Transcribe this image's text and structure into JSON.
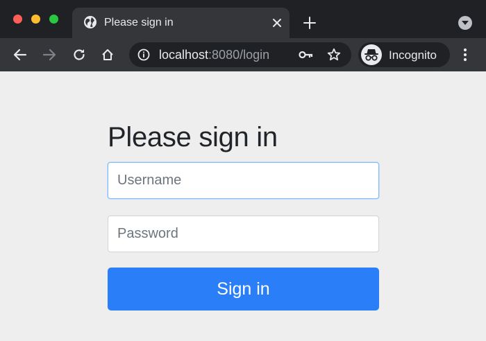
{
  "browser": {
    "tab_title": "Please sign in",
    "url_host": "localhost",
    "url_rest": ":8080/login",
    "profile_label": "Incognito",
    "colors": {
      "chrome_dark": "#202124",
      "chrome_toolbar": "#35363a",
      "close": "#fe5f57",
      "minimize": "#febc2e",
      "maximize": "#28c840"
    }
  },
  "login": {
    "heading": "Please sign in",
    "username_placeholder": "Username",
    "username_value": "",
    "password_placeholder": "Password",
    "password_value": "",
    "submit_label": "Sign in",
    "colors": {
      "background": "#eeeeee",
      "primary": "#2a7ff9",
      "focus_border": "#80bdff"
    }
  },
  "icons": {
    "tab_favicon": "globe-icon",
    "tab_close": "close-icon",
    "new_tab": "plus-icon",
    "tab_search": "chevron-down-icon",
    "back": "arrow-left-icon",
    "forward": "arrow-right-icon",
    "reload": "reload-icon",
    "home": "home-icon",
    "site_info": "info-icon",
    "passwords": "key-icon",
    "bookmark": "star-icon",
    "incognito": "incognito-icon",
    "menu": "kebab-menu-icon"
  }
}
